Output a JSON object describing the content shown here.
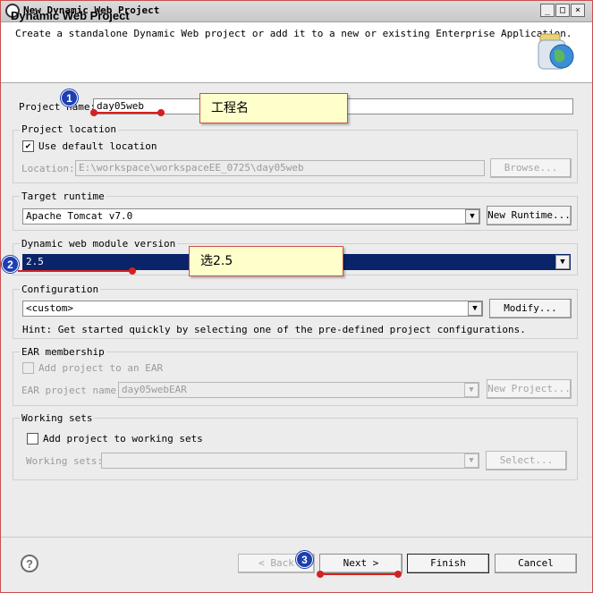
{
  "window": {
    "title": "New Dynamic Web Project"
  },
  "header": {
    "title": "Dynamic Web Project",
    "description": "Create a standalone Dynamic Web project or add it to a new or existing Enterprise Application."
  },
  "project_name": {
    "label": "Project name:",
    "value": "day05web"
  },
  "project_location": {
    "group_label": "Project location",
    "use_default_label": "Use default location",
    "use_default_checked": true,
    "location_label": "Location:",
    "location_value": "E:\\workspace\\workspaceEE_0725\\day05web",
    "browse_label": "Browse..."
  },
  "target_runtime": {
    "group_label": "Target runtime",
    "selected": "Apache Tomcat v7.0",
    "new_runtime_label": "New Runtime..."
  },
  "web_module": {
    "group_label": "Dynamic web module version",
    "selected": "2.5"
  },
  "configuration": {
    "group_label": "Configuration",
    "selected": "<custom>",
    "modify_label": "Modify...",
    "hint": "Hint: Get started quickly by selecting one of the pre-defined project configurations."
  },
  "ear": {
    "group_label": "EAR membership",
    "add_label": "Add project to an EAR",
    "project_name_label": "EAR project name:",
    "project_name_value": "day05webEAR",
    "new_project_label": "New Project..."
  },
  "working_sets": {
    "group_label": "Working sets",
    "add_label": "Add project to working sets",
    "sets_label": "Working sets:",
    "select_label": "Select..."
  },
  "footer": {
    "back_label": "< Back",
    "next_label": "Next >",
    "finish_label": "Finish",
    "cancel_label": "Cancel"
  },
  "annotations": {
    "callout_project_name": "工程名",
    "callout_version": "选2.5",
    "marker_1": "1",
    "marker_2": "2",
    "marker_3": "3"
  },
  "icons": [
    "app-icon",
    "minimize-icon",
    "maximize-icon",
    "close-icon",
    "web-project-graphic",
    "help-icon",
    "dropdown-arrow-icon",
    "checkmark-icon"
  ],
  "colors": {
    "annotation_red": "#d62020",
    "marker_blue": "#1e3fb0",
    "selection_navy": "#0a246a",
    "callout_fill": "#ffffcc"
  }
}
